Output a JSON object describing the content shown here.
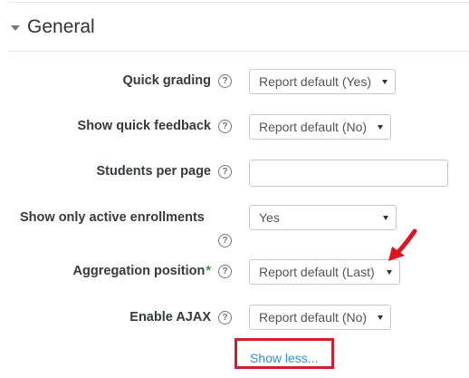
{
  "section": {
    "title": "General"
  },
  "fields": [
    {
      "label": "Quick grading",
      "value": "Report default (Yes)"
    },
    {
      "label": "Show quick feedback",
      "value": "Report default (No)"
    },
    {
      "label": "Students per page",
      "value": ""
    },
    {
      "label": "Show only active enrollments",
      "value": "Yes"
    },
    {
      "label": "Aggregation position",
      "required_mark": "*",
      "value": "Report default (Last)"
    },
    {
      "label": "Enable AJAX",
      "value": "Report default (No)"
    }
  ],
  "help_glyph": "?",
  "show_less": "Show less...",
  "colors": {
    "link": "#2d8fd5",
    "highlight_box": "#d21f2b",
    "arrow": "#e0141e",
    "required": "#2a9f2a"
  }
}
